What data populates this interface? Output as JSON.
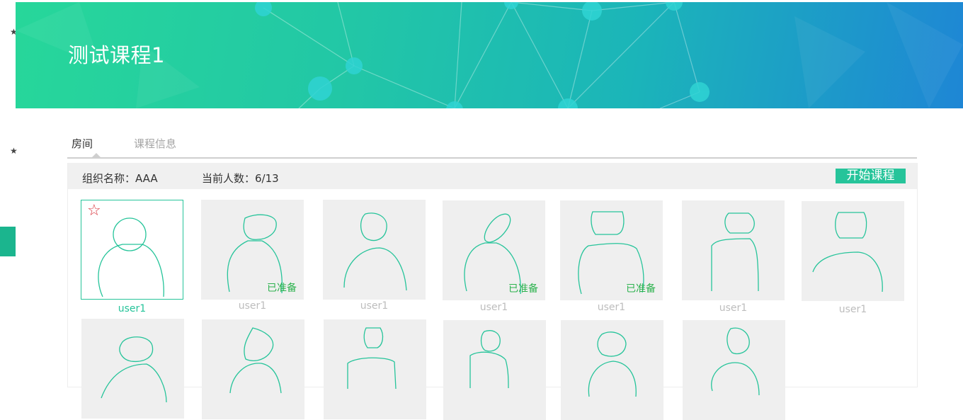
{
  "course": {
    "title": "测试课程1"
  },
  "tabs": [
    {
      "label": "房间",
      "active": true
    },
    {
      "label": "课程信息",
      "active": false
    }
  ],
  "room": {
    "org_text": "组织名称：AAA",
    "count_text": "当前人数：6/13",
    "start_button": "开始课程"
  },
  "participants": [
    {
      "name": "user1",
      "host": true,
      "ready": ""
    },
    {
      "name": "user1",
      "host": false,
      "ready": "已准备"
    },
    {
      "name": "user1",
      "host": false,
      "ready": ""
    },
    {
      "name": "user1",
      "host": false,
      "ready": "已准备"
    },
    {
      "name": "user1",
      "host": false,
      "ready": "已准备"
    },
    {
      "name": "user1",
      "host": false,
      "ready": ""
    },
    {
      "name": "user1",
      "host": false,
      "ready": ""
    }
  ],
  "icons": {
    "host": "star-outline-icon",
    "avatar": "avatar-sketch-icon"
  },
  "colors": {
    "accent": "#26c49a",
    "ready": "#2cb24e",
    "host_star": "#d9363e"
  }
}
